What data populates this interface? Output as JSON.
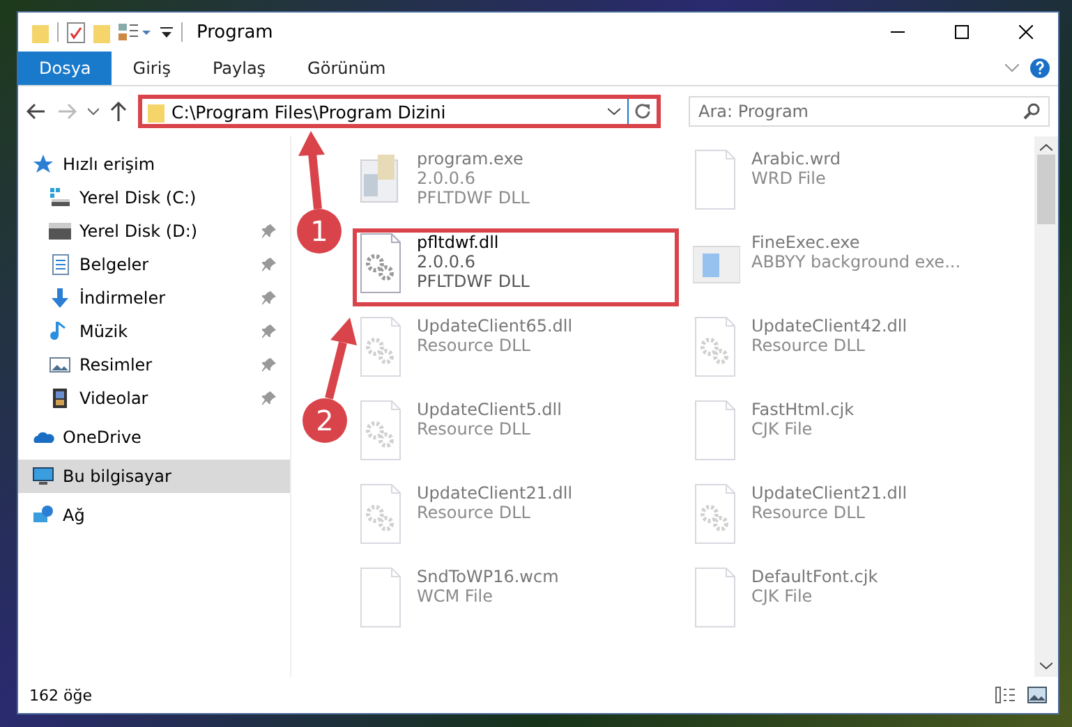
{
  "window": {
    "title": "Program"
  },
  "ribbon_tabs": [
    {
      "label": "Dosya",
      "selected": true
    },
    {
      "label": "Giriş",
      "selected": false
    },
    {
      "label": "Paylaş",
      "selected": false
    },
    {
      "label": "Görünüm",
      "selected": false
    }
  ],
  "address_bar": {
    "path": "C:\\Program Files\\Program Dizini",
    "highlighted": true
  },
  "search": {
    "placeholder": "Ara: Program"
  },
  "sidebar": {
    "items": [
      {
        "label": "Hızlı erişim",
        "kind": "star",
        "selected": false,
        "pinned": false,
        "children": [
          {
            "label": "Yerel Disk (C:)",
            "kind": "drive-win",
            "selected": false,
            "pinned": false
          },
          {
            "label": "Yerel Disk (D:)",
            "kind": "drive",
            "selected": false,
            "pinned": true
          },
          {
            "label": "Belgeler",
            "kind": "docs",
            "selected": false,
            "pinned": true
          },
          {
            "label": "İndirmeler",
            "kind": "download",
            "selected": false,
            "pinned": true
          },
          {
            "label": "Müzik",
            "kind": "music",
            "selected": false,
            "pinned": true
          },
          {
            "label": "Resimler",
            "kind": "pictures",
            "selected": false,
            "pinned": true
          },
          {
            "label": "Videolar",
            "kind": "video",
            "selected": false,
            "pinned": true
          }
        ]
      },
      {
        "label": "OneDrive",
        "kind": "cloud",
        "selected": false,
        "pinned": false
      },
      {
        "label": "Bu bilgisayar",
        "kind": "computer",
        "selected": true,
        "pinned": false
      },
      {
        "label": "Ağ",
        "kind": "network",
        "selected": false,
        "pinned": false
      }
    ]
  },
  "files": [
    {
      "name": "program.exe",
      "lines": [
        "2.0.0.6",
        "PFLTDWF DLL"
      ],
      "kind": "exe",
      "faded": true,
      "highlighted": false
    },
    {
      "name": "Arabic.wrd",
      "lines": [
        "WRD File"
      ],
      "kind": "doc",
      "faded": true,
      "highlighted": false
    },
    {
      "name": "pfltdwf.dll",
      "lines": [
        "2.0.0.6",
        "PFLTDWF DLL"
      ],
      "kind": "dll",
      "faded": false,
      "highlighted": true
    },
    {
      "name": "FineExec.exe",
      "lines": [
        "ABBYY background exe..."
      ],
      "kind": "app",
      "faded": true,
      "highlighted": false
    },
    {
      "name": "UpdateClient65.dll",
      "lines": [
        "Resource DLL"
      ],
      "kind": "dll",
      "faded": true,
      "highlighted": false
    },
    {
      "name": "UpdateClient42.dll",
      "lines": [
        "Resource DLL"
      ],
      "kind": "dll",
      "faded": true,
      "highlighted": false
    },
    {
      "name": "UpdateClient5.dll",
      "lines": [
        "Resource DLL"
      ],
      "kind": "dll",
      "faded": true,
      "highlighted": false
    },
    {
      "name": "FastHtml.cjk",
      "lines": [
        "CJK File"
      ],
      "kind": "doc",
      "faded": true,
      "highlighted": false
    },
    {
      "name": "UpdateClient21.dll",
      "lines": [
        "Resource DLL"
      ],
      "kind": "dll",
      "faded": true,
      "highlighted": false
    },
    {
      "name": "UpdateClient21.dll",
      "lines": [
        "Resource DLL"
      ],
      "kind": "dll",
      "faded": true,
      "highlighted": false
    },
    {
      "name": "SndToWP16.wcm",
      "lines": [
        "WCM File"
      ],
      "kind": "doc",
      "faded": true,
      "highlighted": false
    },
    {
      "name": "DefaultFont.cjk",
      "lines": [
        "CJK File"
      ],
      "kind": "doc",
      "faded": true,
      "highlighted": false
    }
  ],
  "status_bar": {
    "count": "162 öğe"
  },
  "annotations": [
    {
      "label": "1"
    },
    {
      "label": "2"
    }
  ]
}
